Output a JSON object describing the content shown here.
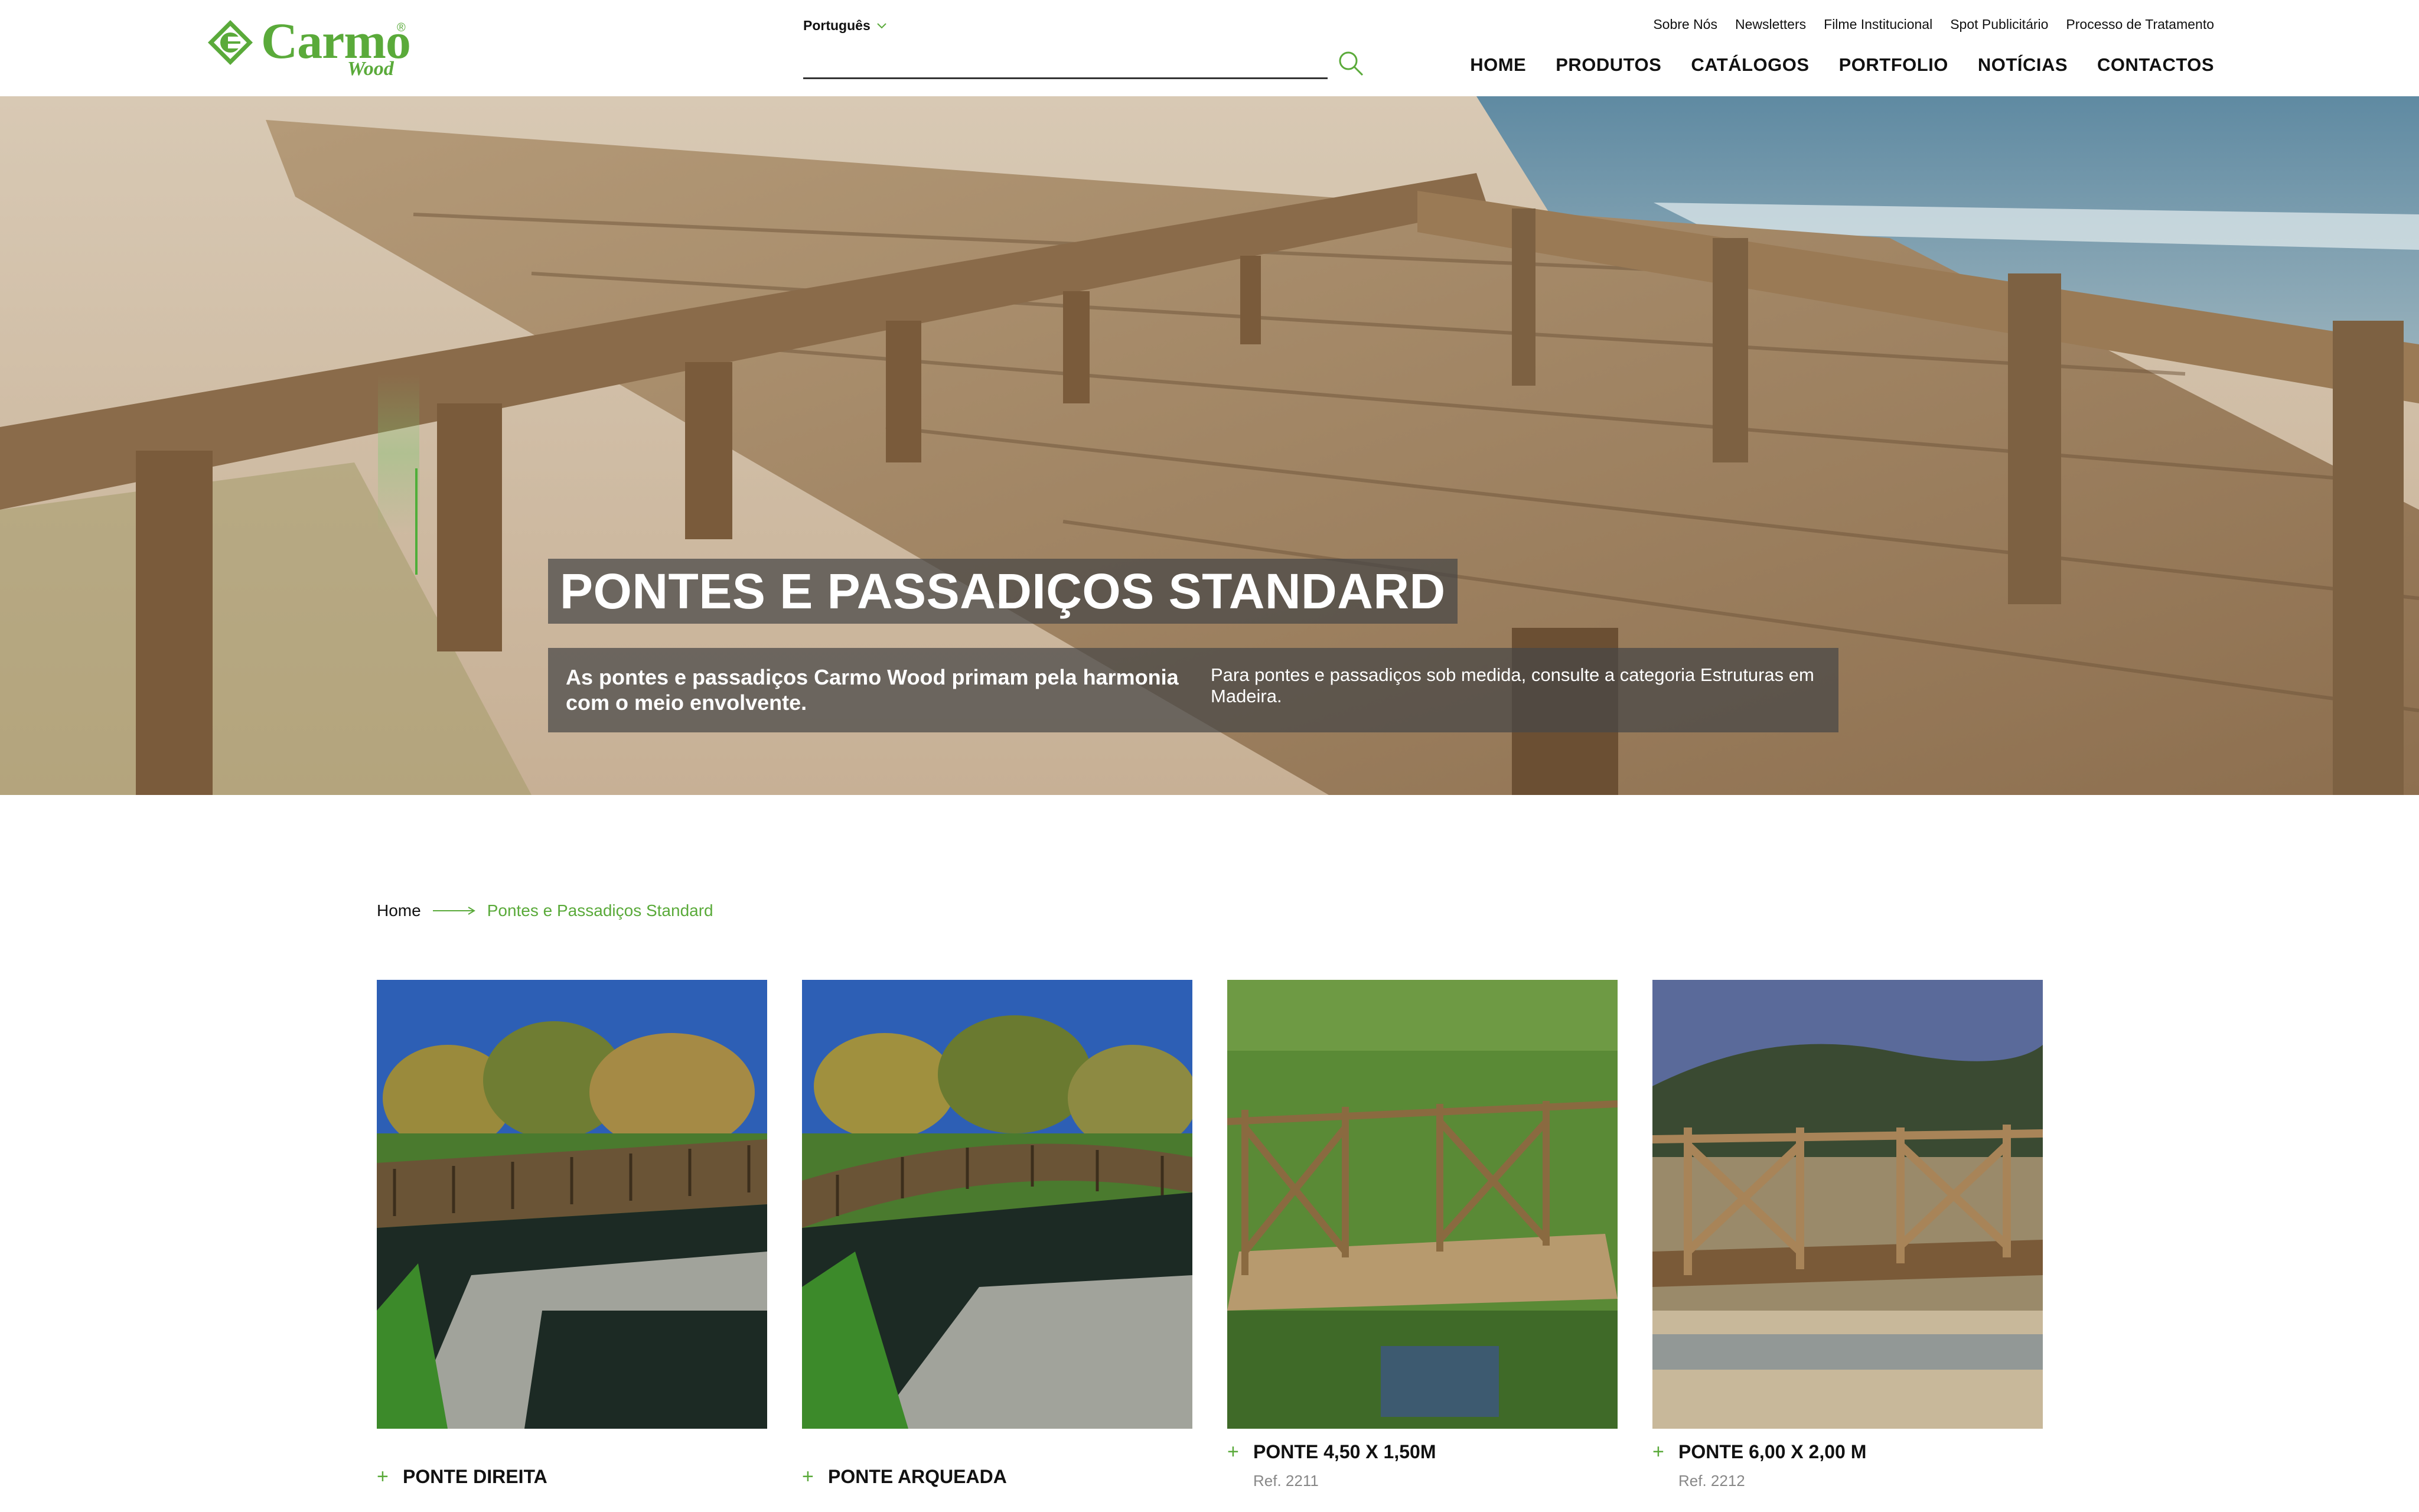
{
  "brand": {
    "name": "Carmo",
    "sub": "Wood",
    "reg": "®"
  },
  "language": {
    "selected": "Português"
  },
  "search": {
    "placeholder": ""
  },
  "top_links": [
    "Sobre Nós",
    "Newsletters",
    "Filme Institucional",
    "Spot Publicitário",
    "Processo de Tratamento"
  ],
  "main_nav": [
    "HOME",
    "PRODUTOS",
    "CATÁLOGOS",
    "PORTFOLIO",
    "NOTÍCIAS",
    "CONTACTOS"
  ],
  "hero": {
    "title": "PONTES E PASSADIÇOS STANDARD",
    "lead": "As pontes e passadiços Carmo Wood primam pela harmonia com o meio envolvente.",
    "note": "Para pontes e passadiços sob medida, consulte a categoria Estruturas em Madeira."
  },
  "breadcrumb": {
    "home": "Home",
    "current": "Pontes e Passadiços Standard"
  },
  "products": [
    {
      "name": "PONTE DIREITA",
      "ref": ""
    },
    {
      "name": "PONTE ARQUEADA",
      "ref": ""
    },
    {
      "name": "PONTE 4,50 X 1,50M",
      "ref": "Ref. 2211"
    },
    {
      "name": "PONTE 6,00 X 2,00 M",
      "ref": "Ref. 2212"
    }
  ],
  "colors": {
    "accent": "#5aaa3a",
    "overlay": "#464646",
    "text": "#111111"
  }
}
